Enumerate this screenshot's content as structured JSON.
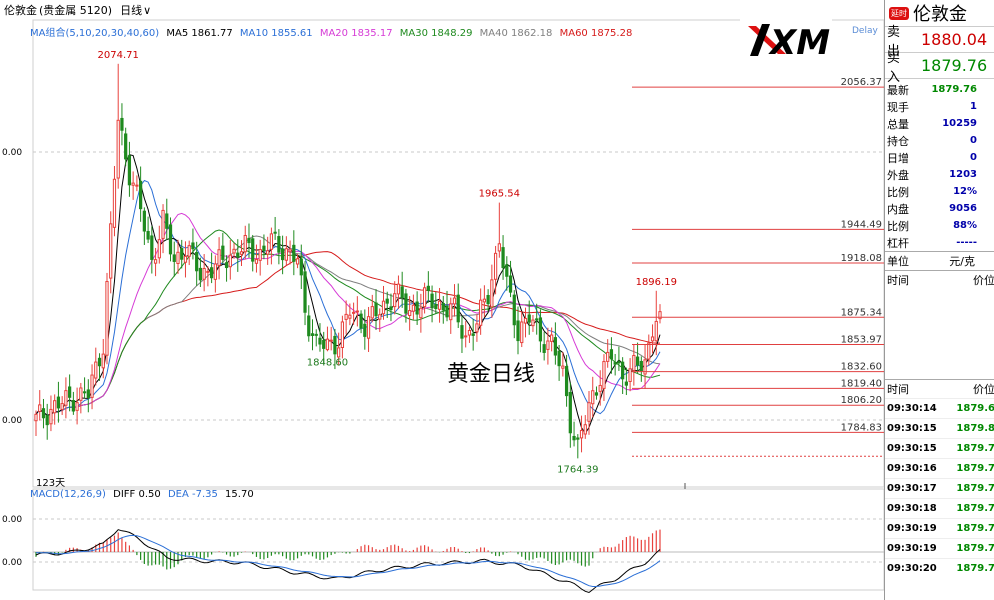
{
  "header": {
    "symbol": "伦敦金",
    "category": "(贵金属 5120)",
    "period": "日线"
  },
  "indicators": {
    "ma_group": "MA组合(5,10,20,30,40,60)",
    "ma5": "MA5 1861.77",
    "ma10": "MA10 1855.61",
    "ma20": "MA20 1835.17",
    "ma30": "MA30 1848.29",
    "ma40": "MA40 1862.18",
    "ma60": "MA60 1875.28",
    "macd": "MACD(12,26,9)",
    "diff": "DIFF 0.50",
    "dea": "DEA -7.35",
    "macd_val": "15.70"
  },
  "colors": {
    "up": "#e8413c",
    "down": "#1f8a1f",
    "ma5": "#000000",
    "ma10": "#2b6fd6",
    "ma20": "#d63bd6",
    "ma30": "#1f8a1f",
    "ma40": "#7f7f7f",
    "ma60": "#d61a1a",
    "level": "#e04040"
  },
  "chart_title": "黄金日线",
  "delay": "Delay",
  "period_days": "123天",
  "axis_labels": {
    "left_mid": "0.00",
    "left_low": "0.00",
    "macd_top": "0.00",
    "macd_zero": "0.00"
  },
  "chart_data": {
    "type": "candlestick",
    "title": "黄金日线",
    "ylim": [
      1745,
      2095
    ],
    "point_labels": [
      {
        "i": 22,
        "price": 2074.71,
        "label": "2074.71",
        "where": "above"
      },
      {
        "i": 78,
        "price": 1848.6,
        "label": "1848.60",
        "where": "below"
      },
      {
        "i": 124,
        "price": 1965.54,
        "label": "1965.54",
        "where": "above"
      },
      {
        "i": 145,
        "price": 1764.39,
        "label": "1764.39",
        "where": "below"
      },
      {
        "i": 166,
        "price": 1896.19,
        "label": "1896.19",
        "where": "above"
      }
    ],
    "levels": [
      2056.37,
      1944.49,
      1918.08,
      1875.34,
      1853.97,
      1832.6,
      1819.4,
      1806.2,
      1784.83
    ],
    "level_labels": [
      "2056.37",
      "1944.49",
      "1918.08",
      "1875.34",
      "1853.97",
      "1832.60",
      "1819.40",
      "1806.20",
      "1784.83"
    ],
    "current_price": 1879.76,
    "anchors": [
      [
        0,
        1795
      ],
      [
        5,
        1805
      ],
      [
        10,
        1812
      ],
      [
        14,
        1815
      ],
      [
        18,
        1855
      ],
      [
        22,
        2030
      ],
      [
        25,
        1990
      ],
      [
        28,
        1960
      ],
      [
        31,
        1920
      ],
      [
        34,
        1950
      ],
      [
        37,
        1920
      ],
      [
        40,
        1930
      ],
      [
        44,
        1910
      ],
      [
        48,
        1915
      ],
      [
        52,
        1925
      ],
      [
        56,
        1930
      ],
      [
        60,
        1925
      ],
      [
        63,
        1935
      ],
      [
        66,
        1930
      ],
      [
        70,
        1920
      ],
      [
        72,
        1880
      ],
      [
        75,
        1855
      ],
      [
        78,
        1852
      ],
      [
        81,
        1858
      ],
      [
        84,
        1880
      ],
      [
        88,
        1870
      ],
      [
        92,
        1880
      ],
      [
        96,
        1895
      ],
      [
        100,
        1880
      ],
      [
        104,
        1890
      ],
      [
        108,
        1885
      ],
      [
        112,
        1880
      ],
      [
        115,
        1860
      ],
      [
        118,
        1870
      ],
      [
        121,
        1895
      ],
      [
        124,
        1935
      ],
      [
        126,
        1900
      ],
      [
        129,
        1865
      ],
      [
        132,
        1875
      ],
      [
        135,
        1860
      ],
      [
        138,
        1855
      ],
      [
        141,
        1830
      ],
      [
        143,
        1795
      ],
      [
        145,
        1772
      ],
      [
        148,
        1805
      ],
      [
        151,
        1830
      ],
      [
        154,
        1845
      ],
      [
        157,
        1830
      ],
      [
        160,
        1835
      ],
      [
        163,
        1840
      ],
      [
        165,
        1868
      ],
      [
        167,
        1882
      ]
    ],
    "macd_anchors": [
      [
        0,
        -2
      ],
      [
        10,
        0
      ],
      [
        18,
        5
      ],
      [
        22,
        16
      ],
      [
        28,
        8
      ],
      [
        35,
        -4
      ],
      [
        45,
        -6
      ],
      [
        55,
        -7
      ],
      [
        70,
        -14
      ],
      [
        80,
        -18
      ],
      [
        92,
        -12
      ],
      [
        105,
        -8
      ],
      [
        120,
        -6
      ],
      [
        130,
        -9
      ],
      [
        142,
        -20
      ],
      [
        148,
        -26
      ],
      [
        155,
        -18
      ],
      [
        163,
        -7
      ],
      [
        167,
        0.5
      ]
    ]
  },
  "side": {
    "badge": "延时",
    "symbol": "伦敦金",
    "sell_label": "卖出",
    "sell": "1880.04",
    "buy_label": "买入",
    "buy": "1879.76",
    "stats": [
      {
        "k": "最新",
        "v": "1879.76",
        "g": true
      },
      {
        "k": "现手",
        "v": "1"
      },
      {
        "k": "总量",
        "v": "10259"
      },
      {
        "k": "持仓",
        "v": "0"
      },
      {
        "k": "日增",
        "v": "0"
      },
      {
        "k": "外盘",
        "v": "1203"
      },
      {
        "k": "比例",
        "v": "12%"
      },
      {
        "k": "内盘",
        "v": "9056"
      },
      {
        "k": "比例",
        "v": "88%"
      },
      {
        "k": "杠杆",
        "v": "-----"
      }
    ],
    "unit_label": "单位",
    "unit": "元/克",
    "time_label": "时间",
    "price_label": "价位",
    "ticks": [
      {
        "t": "09:30:14",
        "p": "1879.6"
      },
      {
        "t": "09:30:15",
        "p": "1879.8"
      },
      {
        "t": "09:30:15",
        "p": "1879.7"
      },
      {
        "t": "09:30:16",
        "p": "1879.7"
      },
      {
        "t": "09:30:17",
        "p": "1879.7"
      },
      {
        "t": "09:30:18",
        "p": "1879.7"
      },
      {
        "t": "09:30:19",
        "p": "1879.7"
      },
      {
        "t": "09:30:19",
        "p": "1879.7"
      },
      {
        "t": "09:30:20",
        "p": "1879.7"
      }
    ]
  }
}
